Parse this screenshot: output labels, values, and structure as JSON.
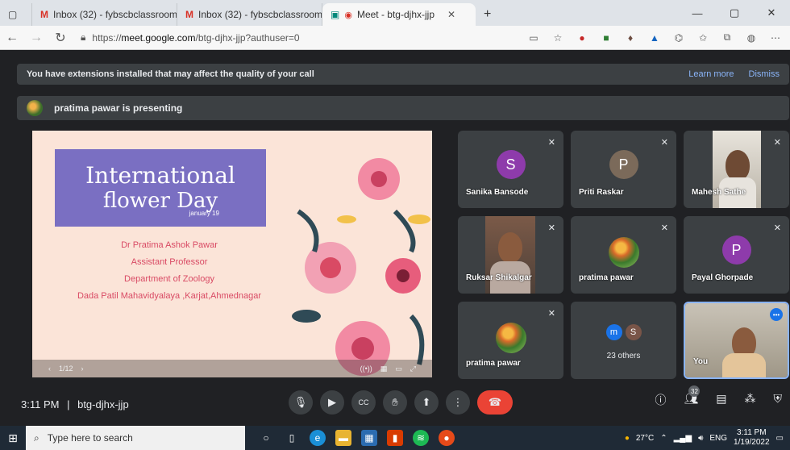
{
  "browser": {
    "tabs": [
      {
        "label": "Inbox (32) - fybscbclassroom@d",
        "icon": "gmail-icon"
      },
      {
        "label": "Inbox (32) - fybscbclassroom@d",
        "icon": "gmail-icon"
      },
      {
        "label": "Meet - btg-djhx-jjp",
        "icon": "meet-icon"
      }
    ],
    "url_prefix": "https://",
    "url_host": "meet.google.com",
    "url_path": "/btg-djhx-jjp?authuser=0"
  },
  "banner": {
    "message": "You have extensions installed that may affect the quality of your call",
    "learn_more": "Learn more",
    "dismiss": "Dismiss"
  },
  "presenting": {
    "text": "pratima pawar is presenting"
  },
  "slide": {
    "title_line1": "International",
    "title_line2": "flower Day",
    "date": "january 19",
    "lines": [
      "Dr Pratima Ashok Pawar",
      "Assistant Professor",
      "Department of Zoology",
      "Dada Patil Mahavidyalaya ,Karjat,Ahmednagar"
    ],
    "page": "1/12"
  },
  "tiles": [
    {
      "name": "Sanika Bansode",
      "initial": "S",
      "color": "#8e3bab"
    },
    {
      "name": "Priti Raskar",
      "initial": "P",
      "color": "#7b6a5a"
    },
    {
      "name": "Mahesh Sathe"
    },
    {
      "name": "Ruksar Shikalgar"
    },
    {
      "name": "pratima pawar"
    },
    {
      "name": "Payal Ghorpade",
      "initial": "P",
      "color": "#8e3bab"
    },
    {
      "name": "pratima pawar"
    },
    {
      "others_label": "23 others",
      "initials": [
        "m",
        "S"
      ]
    },
    {
      "name": "You"
    }
  ],
  "meeting": {
    "time": "3:11 PM",
    "separator": "|",
    "code": "btg-djhx-jjp",
    "participants_count": "32"
  },
  "taskbar": {
    "search_placeholder": "Type here to search",
    "weather": "27°C",
    "lang": "ENG",
    "time": "3:11 PM",
    "date": "1/19/2022"
  }
}
